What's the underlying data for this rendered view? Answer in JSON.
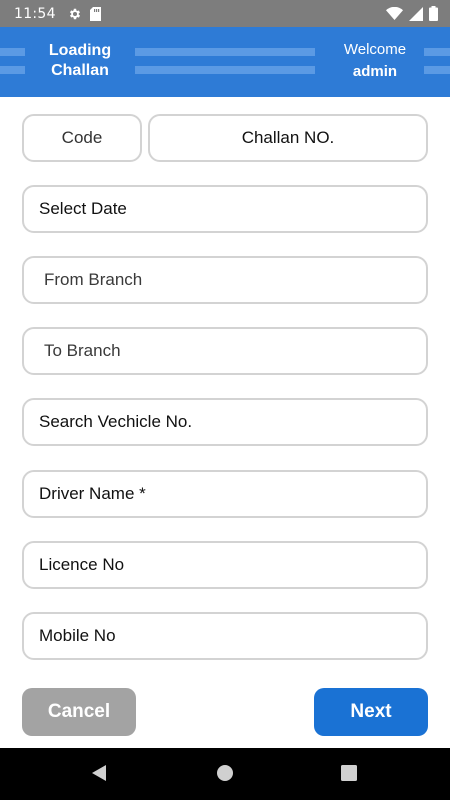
{
  "status_bar": {
    "time": "11:54",
    "icons": [
      "gear-icon",
      "sd-card-icon",
      "wifi-icon",
      "signal-icon",
      "battery-icon"
    ]
  },
  "header": {
    "title_line1": "Loading",
    "title_line2": "Challan",
    "welcome": "Welcome",
    "user": "admin",
    "background": "#2e7bd6"
  },
  "form": {
    "code": "Code",
    "challan_no": "Challan NO.",
    "select_date": "Select Date",
    "from_branch": "From Branch",
    "to_branch": "To Branch",
    "vehicle_search": "Search Vechicle No.",
    "driver_name": "Driver Name *",
    "licence_no": "Licence No",
    "mobile_no": "Mobile No"
  },
  "actions": {
    "cancel": "Cancel",
    "next": "Next",
    "cancel_color": "#a3a3a3",
    "next_color": "#1a72d4"
  },
  "nav_bar": {
    "icons": [
      "back-icon",
      "home-icon",
      "recents-icon"
    ]
  }
}
